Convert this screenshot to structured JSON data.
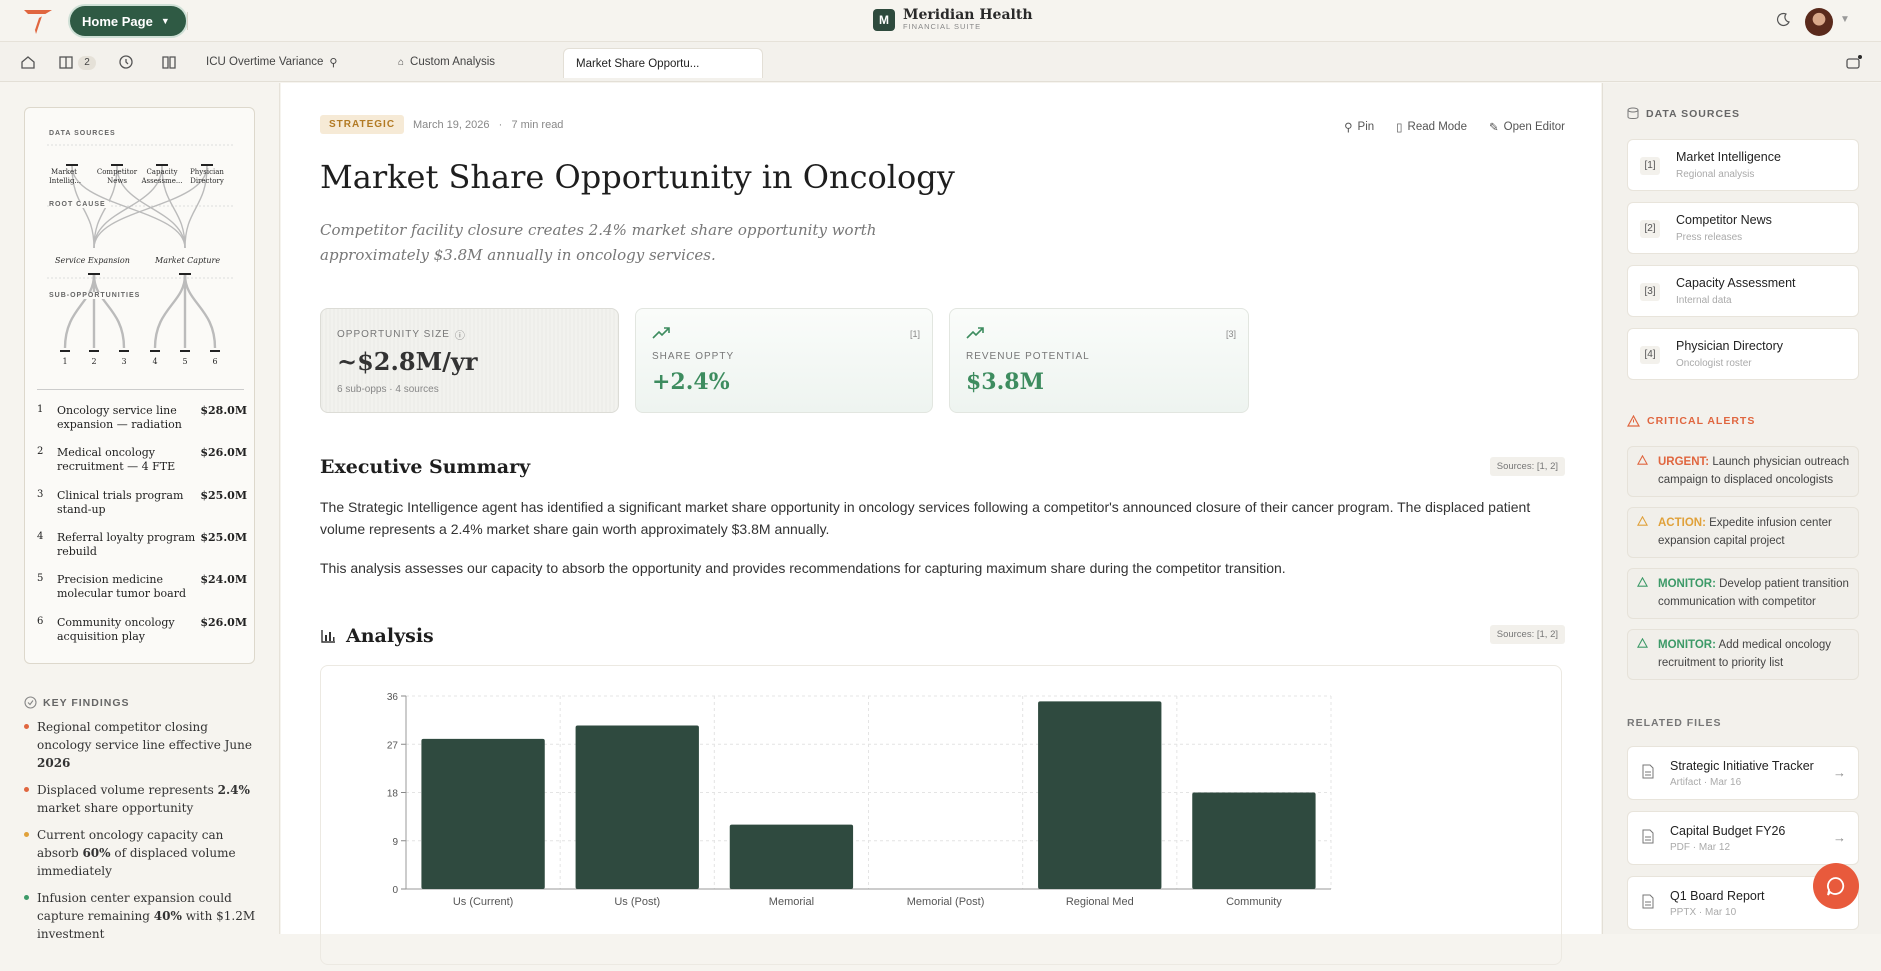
{
  "brand": {
    "name": "Meridian Health",
    "suite": "FINANCIAL SUITE",
    "logo_letter": "M"
  },
  "nav": {
    "home_button": "Home Page",
    "workspace_count": "2"
  },
  "tabs": [
    {
      "label": "ICU Overtime Variance"
    },
    {
      "label": "Custom Analysis"
    },
    {
      "label": "Market Share Opportu..."
    }
  ],
  "tree": {
    "data_sources_label": "DATA SOURCES",
    "root_cause_label": "ROOT CAUSE",
    "sub_opps_label": "SUB-OPPORTUNITIES",
    "sources": [
      "Market Intellig...",
      "Competitor News",
      "Capacity Assessme...",
      "Physician Directory"
    ],
    "causes": [
      "Service Expansion",
      "Market Capture"
    ],
    "leaf_numbers": [
      "1",
      "2",
      "3",
      "4",
      "5",
      "6"
    ],
    "opportunities": [
      {
        "num": "1",
        "text": "Oncology service line expansion — radiation",
        "value": "$28.0M"
      },
      {
        "num": "2",
        "text": "Medical oncology recruitment — 4 FTE",
        "value": "$26.0M"
      },
      {
        "num": "3",
        "text": "Clinical trials program stand-up",
        "value": "$25.0M"
      },
      {
        "num": "4",
        "text": "Referral loyalty program rebuild",
        "value": "$25.0M"
      },
      {
        "num": "5",
        "text": "Precision medicine molecular tumor board",
        "value": "$24.0M"
      },
      {
        "num": "6",
        "text": "Community oncology acquisition play",
        "value": "$26.0M"
      }
    ]
  },
  "key_findings": {
    "title": "KEY FINDINGS",
    "items": [
      {
        "pre": "Regional competitor closing oncology service line effective June ",
        "bold": "2026",
        "post": "",
        "color": "#e0663f"
      },
      {
        "pre": "Displaced volume represents ",
        "bold": "2.4%",
        "post": " market share opportunity",
        "color": "#e0663f"
      },
      {
        "pre": "Current oncology capacity can absorb ",
        "bold": "60%",
        "post": " of displaced volume immediately",
        "color": "#e0a13a"
      },
      {
        "pre": "Infusion center expansion could capture remaining ",
        "bold": "40%",
        "post": " with $1.2M investment",
        "color": "#3d9a68"
      }
    ]
  },
  "article": {
    "tag": "STRATEGIC",
    "date": "March 19, 2026",
    "sep": "·",
    "read_time": "7 min read",
    "actions": {
      "pin": "Pin",
      "read_mode": "Read Mode",
      "open_editor": "Open Editor"
    },
    "title": "Market Share Opportunity in Oncology",
    "subtitle": "Competitor facility closure creates 2.4% market share opportunity worth approximately $3.8M annually in oncology services.",
    "kpis": [
      {
        "label": "OPPORTUNITY SIZE",
        "value": "~$2.8M/yr",
        "sub": "6 sub-opps · 4 sources"
      },
      {
        "label": "SHARE OPPTY",
        "value": "+2.4%",
        "source": "[1]"
      },
      {
        "label": "REVENUE POTENTIAL",
        "value": "$3.8M",
        "source": "[3]"
      }
    ],
    "exec_title": "Executive Summary",
    "exec_sources": "Sources: [1, 2]",
    "exec_p1": "The Strategic Intelligence agent has identified a significant market share opportunity in oncology services following a competitor's announced closure of their cancer program. The displaced patient volume represents a 2.4% market share gain worth approximately $3.8M annually.",
    "exec_p2": "This analysis assesses our capacity to absorb the opportunity and provides recommendations for capturing maximum share during the competitor transition.",
    "analysis_title": "Analysis",
    "analysis_sources": "Sources: [1, 2]"
  },
  "chart_data": {
    "type": "bar",
    "categories": [
      "Us (Current)",
      "Us (Post)",
      "Memorial",
      "Memorial (Post)",
      "Regional Med",
      "Community"
    ],
    "values": [
      28,
      30.5,
      12,
      0,
      35,
      18
    ],
    "ylim": [
      0,
      36
    ],
    "yticks": [
      "0",
      "9",
      "18",
      "27",
      "36"
    ],
    "grid": true,
    "color": "#2f4a3f"
  },
  "sidebar": {
    "sources_title": "DATA SOURCES",
    "sources": [
      {
        "num": "[1]",
        "title": "Market Intelligence",
        "desc": "Regional analysis"
      },
      {
        "num": "[2]",
        "title": "Competitor News",
        "desc": "Press releases"
      },
      {
        "num": "[3]",
        "title": "Capacity Assessment",
        "desc": "Internal data"
      },
      {
        "num": "[4]",
        "title": "Physician Directory",
        "desc": "Oncologist roster"
      }
    ],
    "alerts_title": "CRITICAL ALERTS",
    "alerts": [
      {
        "level": "URGENT:",
        "text": " Launch physician outreach campaign to displaced oncologists",
        "color": "#e0663f"
      },
      {
        "level": "ACTION:",
        "text": " Expedite infusion center expansion capital project",
        "color": "#e0a13a"
      },
      {
        "level": "MONITOR:",
        "text": " Develop patient transition communication with competitor",
        "color": "#3d9a68"
      },
      {
        "level": "MONITOR:",
        "text": " Add medical oncology recruitment to priority list",
        "color": "#3d9a68"
      }
    ],
    "files_title": "RELATED FILES",
    "files": [
      {
        "title": "Strategic Initiative Tracker",
        "meta": "Artifact · Mar 16"
      },
      {
        "title": "Capital Budget FY26",
        "meta": "PDF · Mar 12"
      },
      {
        "title": "Q1 Board Report",
        "meta": "PPTX · Mar 10"
      }
    ]
  }
}
